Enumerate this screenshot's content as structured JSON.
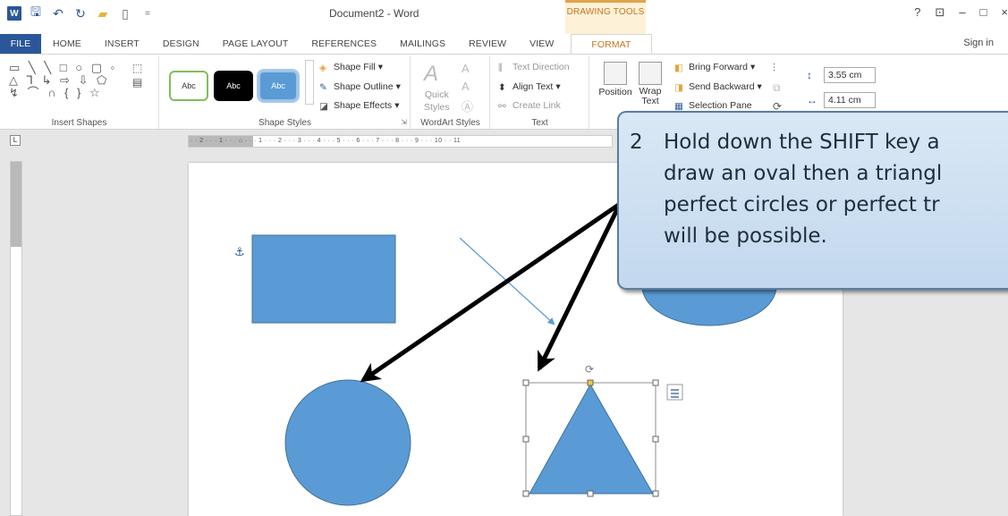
{
  "window": {
    "title": "Document2 - Word",
    "context_tab_group": "DRAWING TOOLS",
    "controls": [
      "?",
      "⊡",
      "–",
      "□",
      "×"
    ],
    "signin": "Sign in"
  },
  "tabs": [
    "FILE",
    "HOME",
    "INSERT",
    "DESIGN",
    "PAGE LAYOUT",
    "REFERENCES",
    "MAILINGS",
    "REVIEW",
    "VIEW"
  ],
  "active_tab": "FORMAT",
  "ribbon": {
    "insert_shapes": {
      "label": "Insert Shapes"
    },
    "shape_styles": {
      "label": "Shape Styles",
      "swatches": [
        "Abc",
        "Abc",
        "Abc"
      ],
      "shape_fill": "Shape Fill",
      "shape_outline": "Shape Outline",
      "shape_effects": "Shape Effects"
    },
    "wordart_styles": {
      "label": "WordArt Styles",
      "quick_styles_1": "Quick",
      "quick_styles_2": "Styles"
    },
    "text": {
      "label": "Text",
      "text_direction": "Text Direction",
      "align_text": "Align Text",
      "create_link": "Create Link"
    },
    "arrange": {
      "position": "Position",
      "wrap_text_1": "Wrap",
      "wrap_text_2": "Text",
      "bring_forward": "Bring Forward",
      "send_backward": "Send Backward",
      "selection_pane": "Selection Pane"
    },
    "size": {
      "height": "3.55 cm",
      "width": "4.11 cm"
    }
  },
  "ruler": {
    "ticks": "· · 2 · · · 1 · · · ⌂ · · · 1 · · · 2 · · · 3 · · · 4 · · · 5 · · · 6 · · · 7 · · · 8 · · · 9 · · · 10 · · 11"
  },
  "callout": {
    "number": "2",
    "lines": [
      "Hold down the SHIFT key a",
      "draw an oval then a triangl",
      "perfect circles or perfect tr",
      "will be possible."
    ]
  },
  "colors": {
    "shape_fill": "#5b9bd5",
    "file_tab": "#2b579a",
    "format_tab": "#c8741c",
    "callout_border": "#5a7da3"
  }
}
